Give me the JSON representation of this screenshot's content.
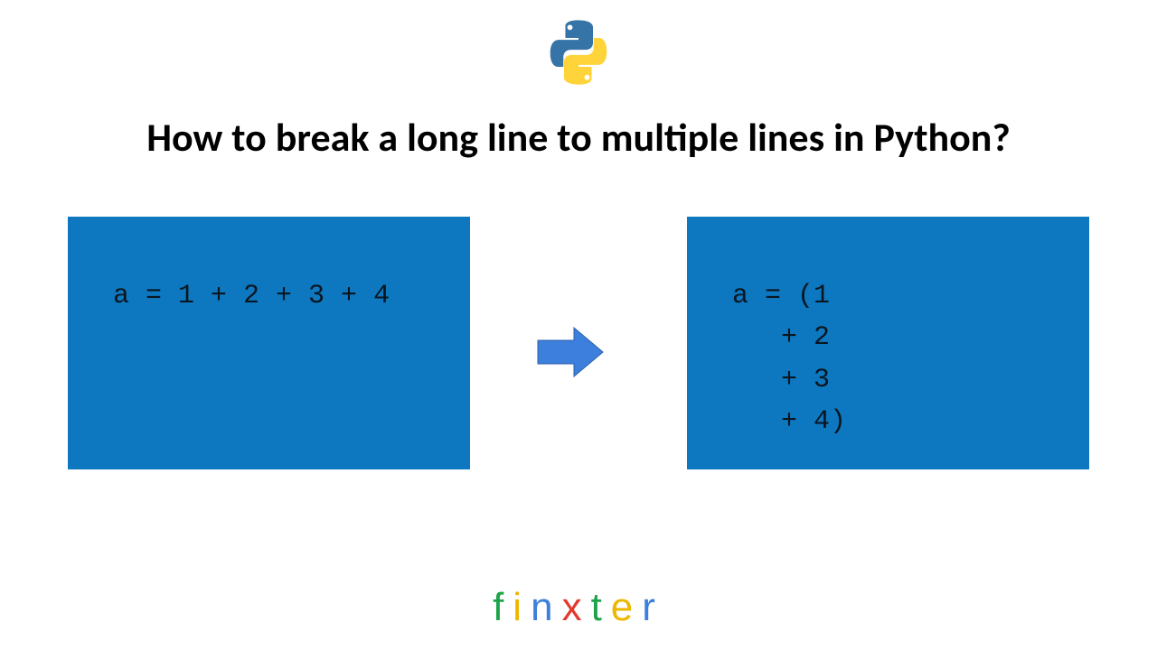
{
  "title": "How to break a long line to multiple lines in Python?",
  "code": {
    "left": "a = 1 + 2 + 3 + 4",
    "right": "a = (1\n     + 2\n     + 3\n     + 4)"
  },
  "brand": {
    "letters": [
      "f",
      "i",
      "n",
      "x",
      "t",
      "e",
      "r"
    ]
  },
  "colors": {
    "code_bg": "#0d78bf",
    "arrow": "#3d7fdc"
  },
  "icons": {
    "logo": "python-logo",
    "arrow": "right-arrow"
  }
}
